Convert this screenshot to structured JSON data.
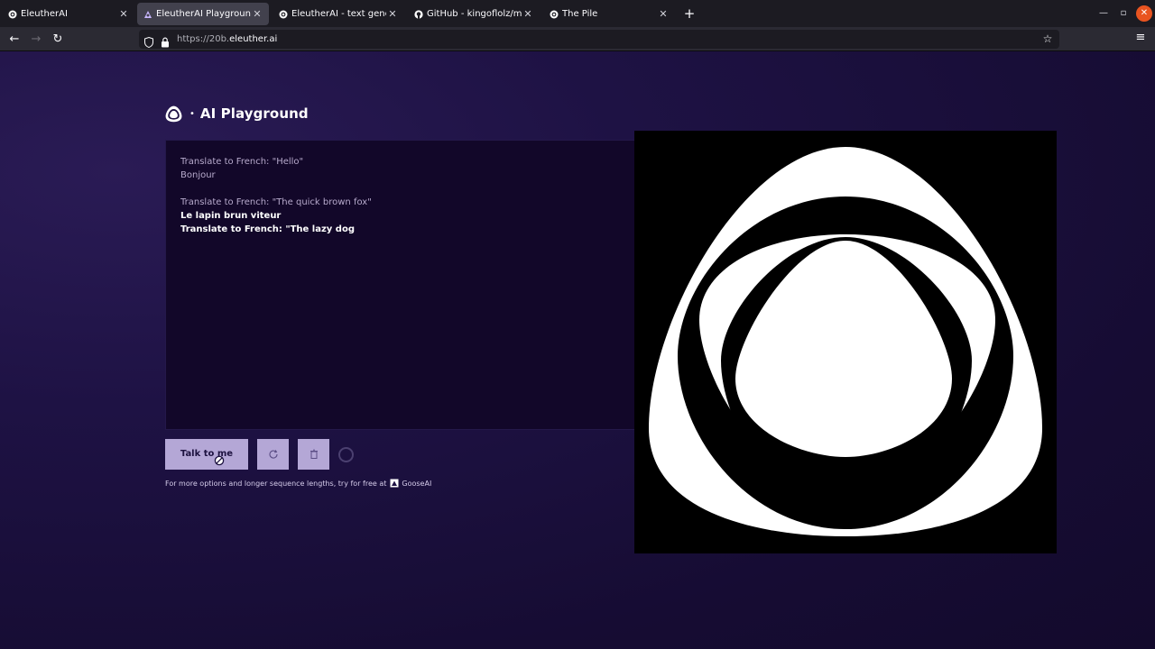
{
  "browser": {
    "tabs": [
      {
        "title": "EleutherAI",
        "active": false
      },
      {
        "title": "EleutherAI Playground",
        "active": true
      },
      {
        "title": "EleutherAI - text generati",
        "active": false
      },
      {
        "title": "GitHub - kingoflolz/mesh",
        "active": false
      },
      {
        "title": "The Pile",
        "active": false
      }
    ],
    "new_tab": "+",
    "url_prefix": "https://20b.",
    "url_domain": "eleuther.ai"
  },
  "page": {
    "brand_dot": "•",
    "brand_title": "AI Playground",
    "prompt_lines": [
      "Translate to French: \"Hello\"",
      "Bonjour",
      "",
      "Translate to French: \"The quick brown fox\""
    ],
    "generated_lines": [
      "Le lapin brun viteur",
      "Translate to French: \"The lazy dog"
    ],
    "talk_button": "Talk to me",
    "footer_text": "For more options and longer sequence lengths, try for free at",
    "footer_link": "GooseAI"
  },
  "colors": {
    "accent": "#b4a7d6",
    "background": "#1a0f33",
    "editor_bg": "#120729"
  }
}
